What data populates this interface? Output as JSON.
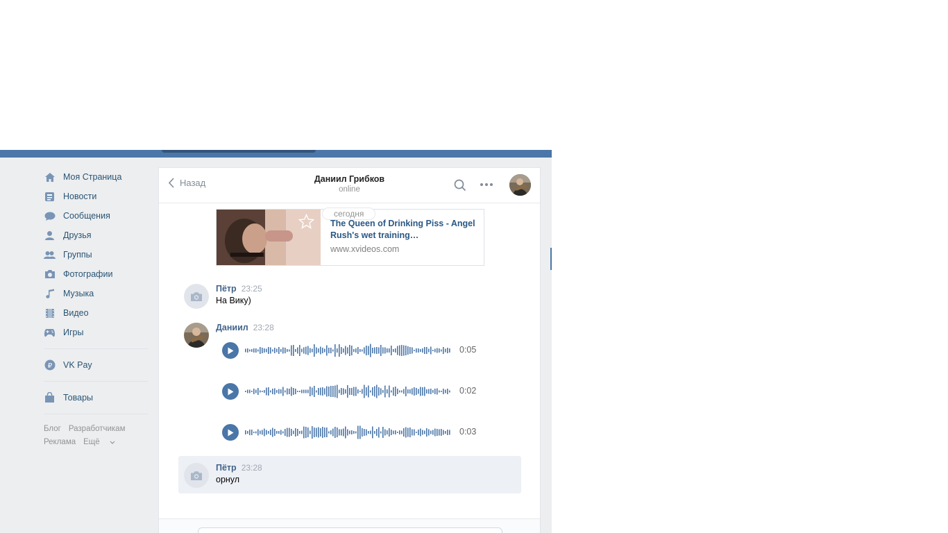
{
  "sidebar": {
    "items": [
      {
        "label": "Моя Страница",
        "icon": "home-icon"
      },
      {
        "label": "Новости",
        "icon": "news-icon"
      },
      {
        "label": "Сообщения",
        "icon": "messages-icon"
      },
      {
        "label": "Друзья",
        "icon": "friend-icon"
      },
      {
        "label": "Группы",
        "icon": "groups-icon"
      },
      {
        "label": "Фотографии",
        "icon": "camera-icon"
      },
      {
        "label": "Музыка",
        "icon": "music-icon"
      },
      {
        "label": "Видео",
        "icon": "video-icon"
      },
      {
        "label": "Игры",
        "icon": "gamepad-icon"
      }
    ],
    "vkpay": {
      "label": "VK Pay",
      "icon": "vkpay-icon"
    },
    "goods": {
      "label": "Товары",
      "icon": "bag-icon"
    },
    "footer": {
      "blog": "Блог",
      "dev": "Разработчикам",
      "ads": "Реклама",
      "more": "Ещё"
    }
  },
  "header": {
    "back_label": "Назад",
    "peer_name": "Даниил Грибков",
    "peer_status": "online"
  },
  "date_divider": "сегодня",
  "link_card": {
    "title": "The Queen of Drinking Piss - Angel Rush's wet training…",
    "domain": "www.xvideos.com"
  },
  "messages": [
    {
      "author": "Пётр",
      "time": "23:25",
      "text": "На Вику)"
    },
    {
      "author": "Даниил",
      "time": "23:28"
    },
    {
      "author": "Пётр",
      "time": "23:28",
      "text": "орнул"
    }
  ],
  "audios": [
    {
      "duration": "0:05"
    },
    {
      "duration": "0:02"
    },
    {
      "duration": "0:03"
    }
  ],
  "colors": {
    "accent": "#4a76a8",
    "link": "#2a5885",
    "author": "#42648b"
  }
}
